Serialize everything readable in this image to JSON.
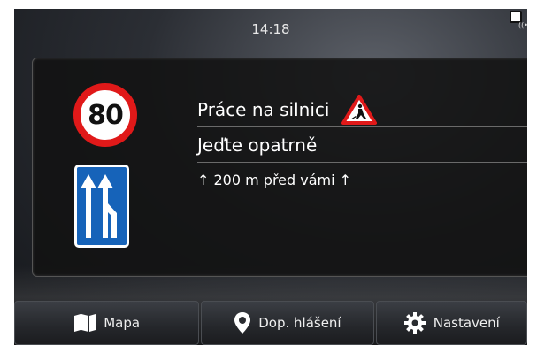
{
  "status_bar": {
    "time": "14:18",
    "wifi_icon": "wifi-signal-icon"
  },
  "signs": {
    "speed_limit": "80",
    "lane_sign_icon": "lane-merge-sign-icon"
  },
  "message": {
    "title": "Práce na silnici",
    "instruction": "Jeďte opatrně",
    "distance": "↑ 200 m před vámi ↑",
    "warning_icon": "roadwork-warning-icon"
  },
  "bottom_bar": {
    "map_label": "Mapa",
    "report_label": "Dop. hlášení",
    "settings_label": "Nastavení"
  },
  "colors": {
    "sign_red": "#e01919",
    "sign_blue": "#1663b9"
  }
}
